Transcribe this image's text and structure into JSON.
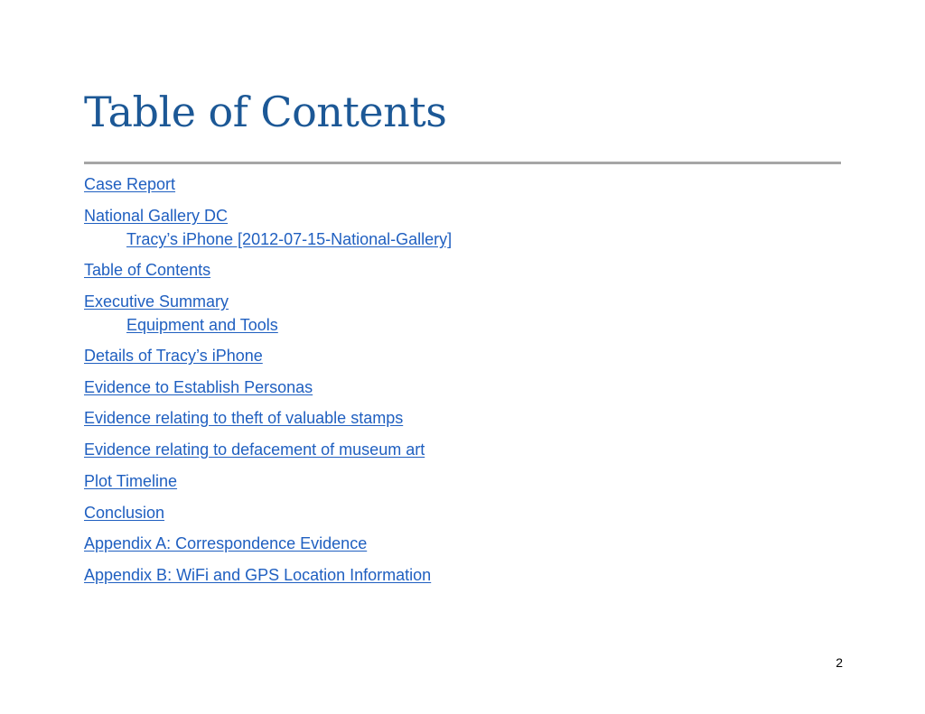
{
  "page": {
    "title": "Table of Contents",
    "page_number": "2"
  },
  "toc": {
    "items": [
      {
        "label": "Case Report",
        "level": 1
      },
      {
        "label": "National Gallery DC",
        "level": 1
      },
      {
        "label": "Tracy’s iPhone [2012-07-15-National-Gallery]",
        "level": 2
      },
      {
        "label": "Table of Contents",
        "level": 1
      },
      {
        "label": "Executive Summary",
        "level": 1
      },
      {
        "label": "Equipment and Tools",
        "level": 2
      },
      {
        "label": "Details of Tracy’s iPhone",
        "level": 1
      },
      {
        "label": "Evidence to Establish Personas",
        "level": 1
      },
      {
        "label": "Evidence relating to theft of valuable stamps",
        "level": 1
      },
      {
        "label": "Evidence relating to defacement of museum art",
        "level": 1
      },
      {
        "label": "Plot Timeline",
        "level": 1
      },
      {
        "label": "Conclusion",
        "level": 1
      },
      {
        "label": "Appendix A: Correspondence Evidence",
        "level": 1
      },
      {
        "label": "Appendix B: WiFi and GPS Location Information",
        "level": 1
      }
    ]
  },
  "colors": {
    "title": "#1c5896",
    "link": "#1f5fc0",
    "rule": "#a6a6a6",
    "page_number": "#000000"
  }
}
